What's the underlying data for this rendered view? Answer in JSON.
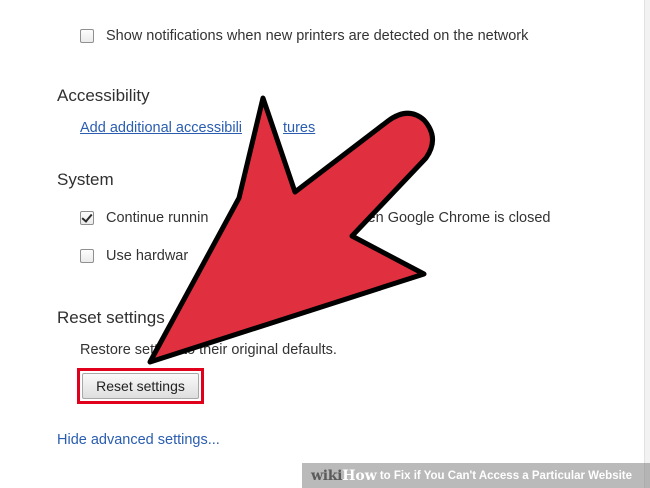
{
  "settings": {
    "network_option": {
      "label": "Show notifications when new printers are detected on the network",
      "checked": false
    },
    "accessibility": {
      "title": "Accessibility",
      "link": "Add additional accessibility features",
      "link_visible_start": "Add additional accessibili",
      "link_visible_end": "tures"
    },
    "system": {
      "title": "System",
      "options": [
        {
          "label": "Continue running background apps when Google Chrome is closed",
          "visible_start": "Continue runnin",
          "visible_end": "when Google Chrome is closed",
          "checked": true
        },
        {
          "label": "Use hardware acceleration when available",
          "visible_start": "Use hardwar",
          "checked": false
        }
      ]
    },
    "reset": {
      "title": "Reset settings",
      "description": "Restore settings to their original defaults.",
      "description_visible_start": "Restore sett",
      "description_visible_end": "to their original defaults.",
      "button_label": "Reset settings"
    },
    "hide_advanced_link": "Hide advanced settings..."
  },
  "overlay": {
    "arrow_color": "#e0303f",
    "highlight_color": "#e0001b"
  },
  "watermark": {
    "site": "wiki",
    "how": "How",
    "caption": "to Fix if You Can't Access a Particular Website"
  }
}
